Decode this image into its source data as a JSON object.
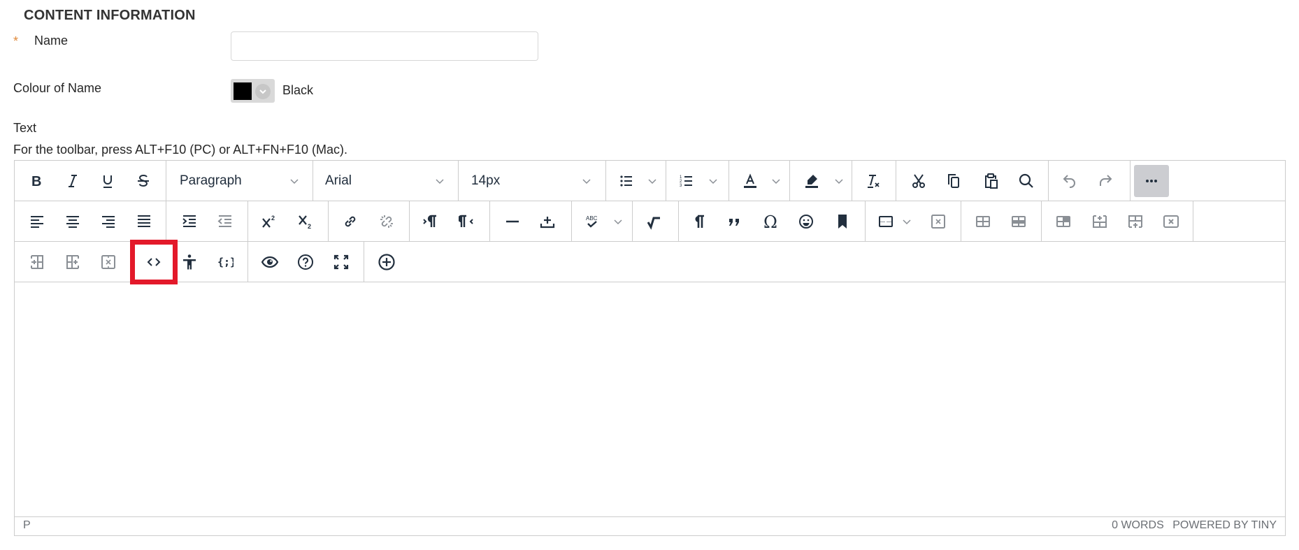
{
  "section": {
    "title": "CONTENT INFORMATION"
  },
  "name_field": {
    "required_marker": "*",
    "label": "Name",
    "value": "",
    "placeholder": ""
  },
  "colour_field": {
    "label": "Colour of Name",
    "value": "Black",
    "swatch_color": "#000000"
  },
  "text_field": {
    "label": "Text",
    "toolbar_hint": "For the toolbar, press ALT+F10 (PC) or ALT+FN+F10 (Mac)."
  },
  "editor": {
    "toolbar": {
      "block_format": "Paragraph",
      "font_family": "Arial",
      "font_size": "14px",
      "row1": [
        "bold",
        "italic",
        "underline",
        "strikethrough",
        "block-format",
        "font-family",
        "font-size",
        "bullet-list",
        "numbered-list",
        "text-color",
        "highlight-color",
        "clear-formatting",
        "cut",
        "copy",
        "paste",
        "find-replace",
        "undo",
        "redo",
        "more"
      ],
      "row2": [
        "align-left",
        "align-center",
        "align-right",
        "justify",
        "indent",
        "outdent",
        "superscript",
        "subscript",
        "link",
        "unlink",
        "ltr",
        "rtl",
        "horizontal-line",
        "insert-above",
        "spellcheck",
        "math",
        "show-blocks",
        "blockquote",
        "special-character",
        "emoticons",
        "bookmark",
        "table",
        "delete-table",
        "table-cell-props",
        "table-row-props",
        "table-merge",
        "table-insert-row-before",
        "table-insert-row-after",
        "table-delete-row"
      ],
      "row3": [
        "table-insert-col-before",
        "table-insert-col-after",
        "table-delete-col",
        "source-code",
        "accessibility-checker",
        "code-sample",
        "preview",
        "help",
        "fullscreen",
        "insert"
      ]
    },
    "highlighted_button": "source-code",
    "highlight_color": "#e3192a",
    "content": "",
    "statusbar": {
      "path": "P",
      "word_count": "0 WORDS",
      "branding": "POWERED BY TINY"
    }
  }
}
